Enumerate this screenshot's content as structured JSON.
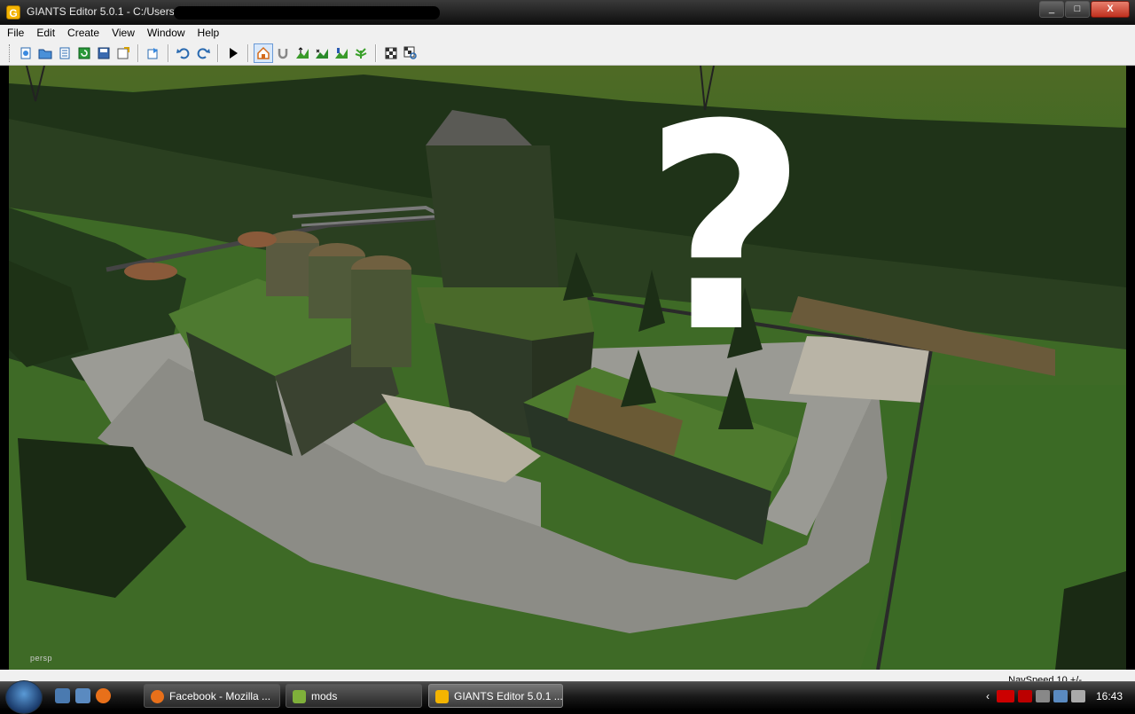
{
  "window": {
    "title": "GIANTS Editor 5.0.1 - C:/Users/",
    "minimize": "_",
    "maximize": "□",
    "close": "X"
  },
  "menu": [
    "File",
    "Edit",
    "Create",
    "View",
    "Window",
    "Help"
  ],
  "toolbar": {
    "icons": [
      "new-icon",
      "open-icon",
      "properties-icon",
      "refresh-icon",
      "save-icon",
      "export-icon",
      "import-icon",
      "undo-icon",
      "redo-icon",
      "play-icon",
      "home-icon",
      "magnet-icon",
      "terrain-raise-icon",
      "terrain-smooth-icon",
      "terrain-paint-icon",
      "foliage-icon",
      "checker-icon",
      "checker-zoom-icon"
    ]
  },
  "viewport": {
    "camera_label": "persp",
    "question_mark": "?"
  },
  "status": {
    "navspeed": "NavSpeed 10 +/-"
  },
  "taskbar": {
    "tasks": [
      {
        "label": "Facebook - Mozilla ...",
        "color": "#e8701a"
      },
      {
        "label": "mods",
        "color": "#7fb03a"
      },
      {
        "label": "GIANTS Editor 5.0.1 ...",
        "color": "#f4b400"
      }
    ],
    "clock": "16:43"
  }
}
